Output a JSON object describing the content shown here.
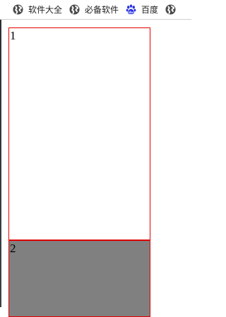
{
  "bookmarks": [
    {
      "label": "软件大全",
      "icon": "globe-icon"
    },
    {
      "label": "必备软件",
      "icon": "globe-icon"
    },
    {
      "label": "百度",
      "icon": "baidu-paw-icon"
    },
    {
      "label": "",
      "icon": "globe-icon"
    }
  ],
  "content": {
    "box1_label": "1",
    "box2_label": "2"
  },
  "colors": {
    "border": "#e00000",
    "box2_fill": "#808080",
    "baidu_blue": "#2932e1"
  }
}
